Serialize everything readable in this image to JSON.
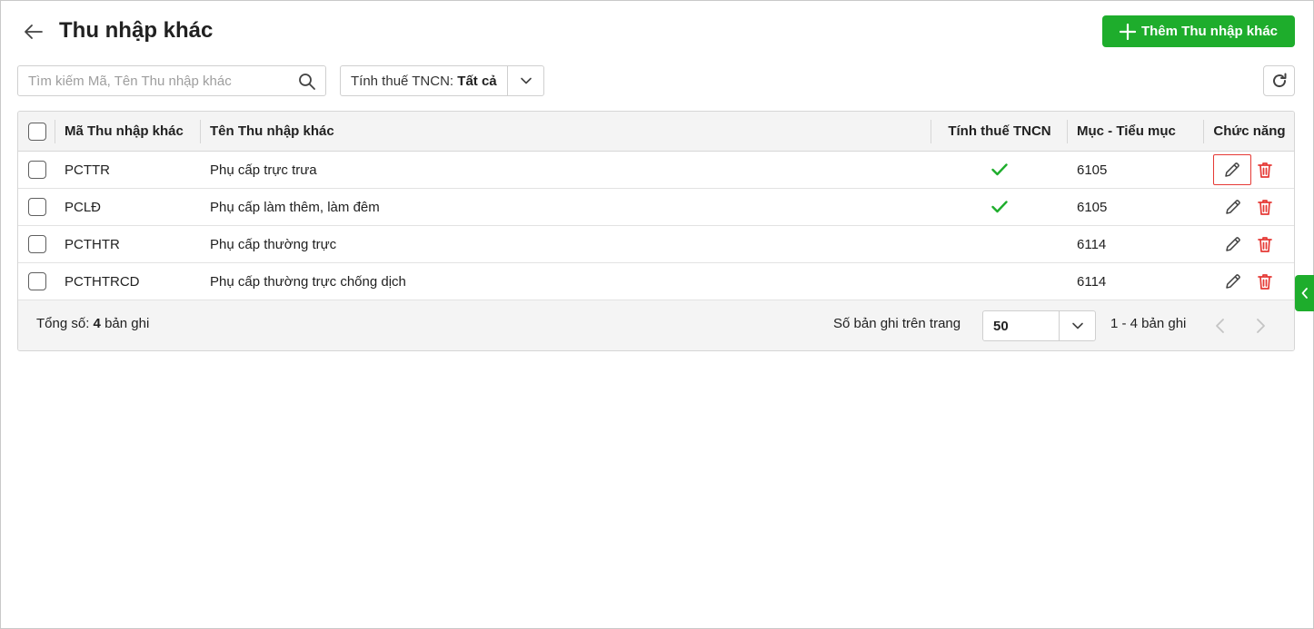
{
  "header": {
    "title": "Thu nhập khác",
    "add_button_label": "Thêm Thu nhập khác"
  },
  "toolbar": {
    "search_placeholder": "Tìm kiếm Mã, Tên Thu nhập khác",
    "search_value": "",
    "filter_label": "Tính thuế TNCN:",
    "filter_value": "Tất cả"
  },
  "table": {
    "columns": {
      "code": "Mã Thu nhập khác",
      "name": "Tên Thu nhập khác",
      "tax": "Tính thuế TNCN",
      "category": "Mục - Tiểu mục",
      "actions": "Chức năng"
    },
    "rows": [
      {
        "code": "PCTTR",
        "name": "Phụ cấp trực trưa",
        "tax": true,
        "category": "6105"
      },
      {
        "code": "PCLĐ",
        "name": "Phụ cấp làm thêm, làm đêm",
        "tax": true,
        "category": "6105"
      },
      {
        "code": "PCTHTR",
        "name": "Phụ cấp thường trực",
        "tax": false,
        "category": "6114"
      },
      {
        "code": "PCTHTRCD",
        "name": "Phụ cấp thường trực chống dịch",
        "tax": false,
        "category": "6114"
      }
    ]
  },
  "footer": {
    "total_label": "Tổng số:",
    "total_count": "4",
    "total_suffix": "bản ghi",
    "per_page_label": "Số bản ghi trên trang",
    "per_page_value": "50",
    "range_text": "1 - 4 bản ghi"
  },
  "colors": {
    "primary_green": "#1ead2c",
    "check_green": "#1ead2c",
    "delete_red": "#e53935",
    "focus_border": "#e53935"
  },
  "icons": {
    "back": "arrow-left-icon",
    "add": "plus-icon",
    "search": "search-icon",
    "dropdown": "chevron-down-icon",
    "refresh": "refresh-icon",
    "edit": "pencil-icon",
    "delete": "trash-icon",
    "tax_yes": "checkmark-icon",
    "prev": "chevron-left-icon",
    "next": "chevron-right-icon",
    "side_panel": "chevron-left-icon"
  }
}
